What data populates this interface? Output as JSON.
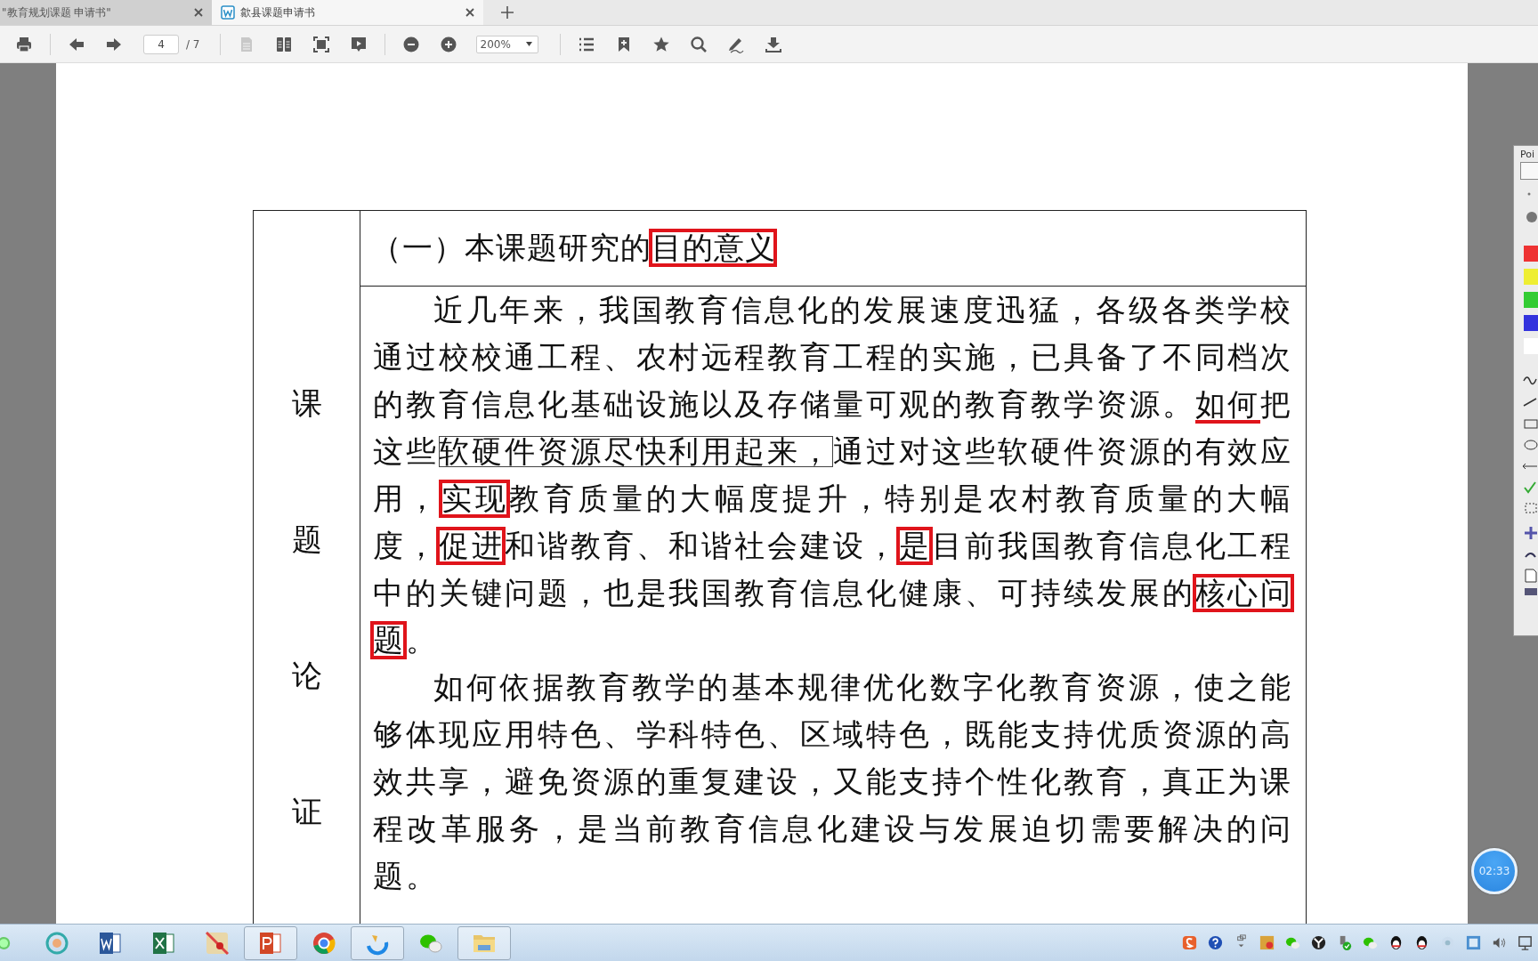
{
  "tabs": [
    {
      "label": "\"教育规划课题 申请书\"",
      "selected": false
    },
    {
      "label": "歙县课题申请书",
      "selected": true
    }
  ],
  "toolbar": {
    "page": "4",
    "page_total": "/ 7",
    "zoom": "200%"
  },
  "document": {
    "side_label": "课题论证",
    "heading": [
      {
        "text": "（一）本课题研究的"
      },
      {
        "text": "目的意义",
        "kind": "box"
      }
    ],
    "paragraphs": [
      {
        "segments": [
          {
            "text": "近几年来，我国教育信息化的发展速度迅猛，各级各类学校通过校校通工程、农村远程教育工程的实施，已具备了不同档次的教育信息化基础设施以及存储量可观的教育教学资源。"
          },
          {
            "text": "如何",
            "kind": "underline"
          },
          {
            "text": "把这些"
          },
          {
            "text": "软硬件资源尽快利用起来，",
            "kind": "select"
          },
          {
            "text": "通过对这些软硬件资源的有效应用，"
          },
          {
            "text": "实现",
            "kind": "box"
          },
          {
            "text": "教育质量的大幅度提升，特别是农村教育质量的大幅度，"
          },
          {
            "text": "促进",
            "kind": "box"
          },
          {
            "text": "和谐教育、和谐社会建设，"
          },
          {
            "text": "是",
            "kind": "box"
          },
          {
            "text": "目前我国教育信息化工程中的关键问题，也是我国教育信息化健康、可持续发展的"
          },
          {
            "text": "核心问题",
            "kind": "box"
          },
          {
            "text": "。"
          }
        ]
      },
      {
        "segments": [
          {
            "text": "如何依据教育教学的基本规律优化数字化教育资源，使之能够体现应用特色、学科特色、区域特色，既能支持优质资源的高效共享，避免资源的重复建设，又能支持个性化教育，真正为课程改革服务，是当前教育信息化建设与发展迫切需要解决的问题。"
          }
        ]
      }
    ]
  },
  "palette": {
    "title": "Poi"
  },
  "timer": "02:33"
}
